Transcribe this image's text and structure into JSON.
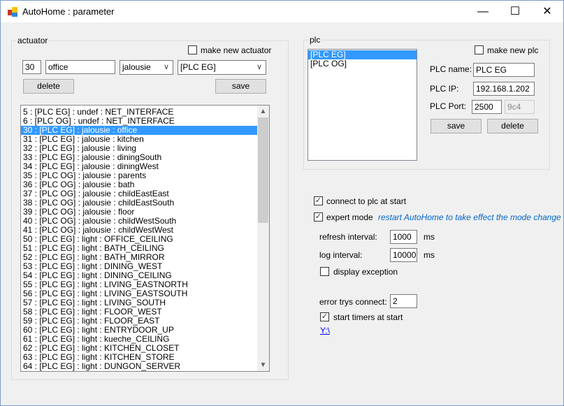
{
  "window": {
    "title": "AutoHome : parameter",
    "minimize": "—",
    "maximize": "☐",
    "close": "✕"
  },
  "actuator": {
    "group_label": "actuator",
    "make_new_label": "make new actuator",
    "make_new_checked": false,
    "id": "30",
    "name": "office",
    "type": "jalousie",
    "plc": "[PLC EG]",
    "delete_label": "delete",
    "save_label": "save",
    "items": [
      "5 : [PLC EG]  : undef : NET_INTERFACE",
      "6 : [PLC OG]  : undef : NET_INTERFACE",
      "30 : [PLC EG]  : jalousie : office",
      "31 : [PLC EG]  : jalousie : kitchen",
      "32 : [PLC EG]  : jalousie : living",
      "33 : [PLC EG]  : jalousie : diningSouth",
      "34 : [PLC EG]  : jalousie : diningWest",
      "35 : [PLC OG]  : jalousie : parents",
      "36 : [PLC OG]  : jalousie : bath",
      "37 : [PLC OG]  : jalousie : childEastEast",
      "38 : [PLC OG]  : jalousie : childEastSouth",
      "39 : [PLC OG]  : jalousie : floor",
      "40 : [PLC OG]  : jalousie : childWestSouth",
      "41 : [PLC OG]  : jalousie : childWestWest",
      "50 : [PLC EG]  : light : OFFICE_CEILING",
      "51 : [PLC EG]  : light : BATH_CEILING",
      "52 : [PLC EG]  : light : BATH_MIRROR",
      "53 : [PLC EG]  : light : DINING_WEST",
      "54 : [PLC EG]  : light : DINING_CEILING",
      "55 : [PLC EG]  : light : LIVING_EASTNORTH",
      "56 : [PLC EG]  : light : LIVING_EASTSOUTH",
      "57 : [PLC EG]  : light : LIVING_SOUTH",
      "58 : [PLC EG]  : light : FLOOR_WEST",
      "59 : [PLC EG]  : light : FLOOR_EAST",
      "60 : [PLC EG]  : light : ENTRYDOOR_UP",
      "61 : [PLC EG]  : light : kueche_CEILING",
      "62 : [PLC EG]  : light : KITCHEN_CLOSET",
      "63 : [PLC EG]  : light : KITCHEN_STORE",
      "64 : [PLC EG]  : light : DUNGON_SERVER"
    ],
    "selected_index": 2
  },
  "plc": {
    "group_label": "plc",
    "items": [
      "[PLC EG]",
      "[PLC OG]"
    ],
    "selected_index": 0,
    "make_new_label": "make new plc",
    "make_new_checked": false,
    "name_label": "PLC name:",
    "name": "PLC EG",
    "ip_label": "PLC IP:",
    "ip": "192.168.1.202",
    "port_label": "PLC Port:",
    "port": "2500",
    "port_hex": "9c4",
    "save_label": "save",
    "delete_label": "delete"
  },
  "settings": {
    "connect_label": "connect to plc at start",
    "connect_checked": true,
    "expert_label": "expert mode",
    "expert_checked": true,
    "restart_note": "restart AutoHome to take effect the mode change",
    "refresh_label": "refresh interval:",
    "refresh_value": "1000",
    "refresh_unit": "ms",
    "log_label": "log interval:",
    "log_value": "10000",
    "log_unit": "ms",
    "display_exception_label": "display exception",
    "display_exception_checked": false,
    "error_trys_label": "error trys connect:",
    "error_trys_value": "2",
    "start_timers_label": "start timers at start",
    "start_timers_checked": true,
    "path_link": "Y:\\"
  },
  "colors": {
    "selection": "#3399ff",
    "note": "#0066cc",
    "link": "#0000ff"
  }
}
